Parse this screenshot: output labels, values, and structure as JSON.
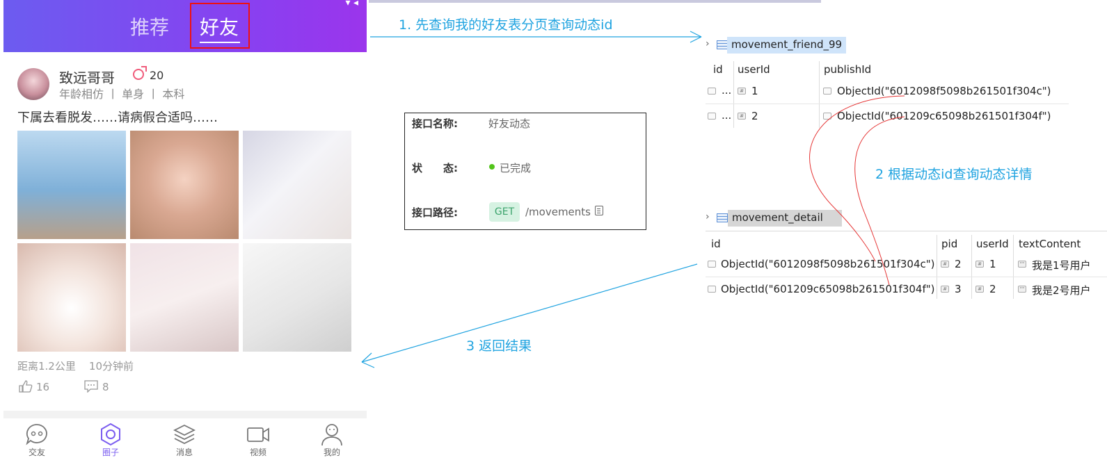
{
  "phone": {
    "tabs": {
      "recommend": "推荐",
      "friend": "好友"
    },
    "post": {
      "user_name": "致远哥哥",
      "age": "20",
      "tags": "年龄相仿 丨 单身 丨 本科",
      "text": "下属去看脱发……请病假合适吗……",
      "meta": "距离1.2公里    10分钟前",
      "likes": "16",
      "comments": "8"
    },
    "nav": [
      {
        "label": "交友",
        "icon": "chat-face-icon"
      },
      {
        "label": "圈子",
        "icon": "hexagon-circle-icon"
      },
      {
        "label": "消息",
        "icon": "layers-icon"
      },
      {
        "label": "视频",
        "icon": "video-camera-icon"
      },
      {
        "label": "我的",
        "icon": "user-icon"
      }
    ],
    "colors": {
      "header_start": "#6c5cf0",
      "header_end": "#9b35ec",
      "highlight": "#ee1111",
      "active": "#7a5cf0"
    }
  },
  "api": {
    "name_label": "接口名称:",
    "name_value": "好友动态",
    "status_label": "状　　态:",
    "status_value": "已完成",
    "path_label": "接口路径:",
    "method": "GET",
    "path": "/movements"
  },
  "table_friend": {
    "name": "movement_friend_99",
    "columns": [
      "id",
      "userId",
      "publishId"
    ],
    "rows": [
      {
        "id": "...",
        "userId": "1",
        "publishId": "ObjectId(\"6012098f5098b261501f304c\")"
      },
      {
        "id": "...",
        "userId": "2",
        "publishId": "ObjectId(\"601209c65098b261501f304f\")"
      }
    ]
  },
  "table_detail": {
    "name": "movement_detail",
    "columns": [
      "id",
      "pid",
      "userId",
      "textContent"
    ],
    "rows": [
      {
        "id": "ObjectId(\"6012098f5098b261501f304c\")",
        "pid": "2",
        "userId": "1",
        "textContent": "我是1号用户"
      },
      {
        "id": "ObjectId(\"601209c65098b261501f304f\")",
        "pid": "3",
        "userId": "2",
        "textContent": "我是2号用户"
      }
    ]
  },
  "annotations": {
    "step1": "1. 先查询我的好友表分页查询动态id",
    "step2": "2 根据动态id查询动态详情",
    "step3": "3 返回结果",
    "arrow_color": "#1fa3e0",
    "link_color": "#e53333"
  }
}
